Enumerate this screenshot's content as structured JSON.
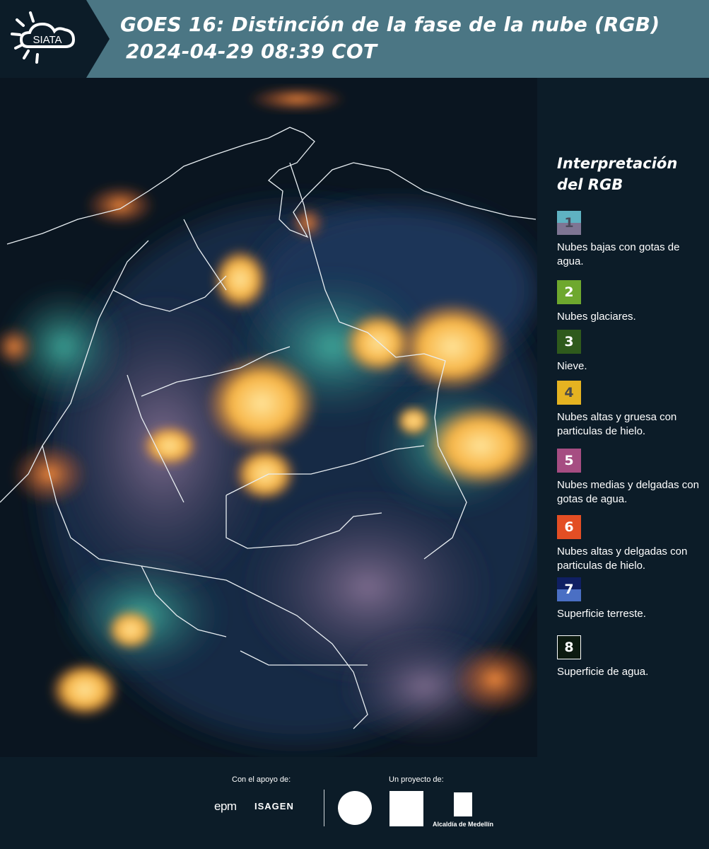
{
  "header": {
    "logo_text": "SIATA",
    "title_line1": "GOES 16: Distinción de la fase de la nube (RGB)",
    "title_line2": "2024-04-29 08:39 COT"
  },
  "legend": {
    "title_line1": "Interpretación",
    "title_line2": "del RGB",
    "items": [
      {
        "number": "1",
        "label": "Nubes bajas con gotas de agua.",
        "color_top": "#5fb2c2",
        "color_bottom": "#7e7593",
        "number_color": "#4a4a5a"
      },
      {
        "number": "2",
        "label": "Nubes glaciares.",
        "color_top": "#6ea82e",
        "color_bottom": "#6ea82e",
        "number_color": "#ffffff"
      },
      {
        "number": "3",
        "label": "Nieve.",
        "color_top": "#2f5a1c",
        "color_bottom": "#2f5a1c",
        "number_color": "#ffffff"
      },
      {
        "number": "4",
        "label": "Nubes altas y gruesa con particulas de hielo.",
        "color_top": "#e5b321",
        "color_bottom": "#e5b321",
        "number_color": "#4a4a4a"
      },
      {
        "number": "5",
        "label": "Nubes medias y delgadas con gotas de agua.",
        "color_top": "#a64d82",
        "color_bottom": "#a64d82",
        "number_color": "#ffffff"
      },
      {
        "number": "6",
        "label": "Nubes altas y delgadas con particulas de hielo.",
        "color_top": "#e34e24",
        "color_bottom": "#e34e24",
        "number_color": "#ffffff"
      },
      {
        "number": "7",
        "label": "Superficie terreste.",
        "color_top": "#0f1f63",
        "color_bottom": "#4a6fc4",
        "number_color": "#ffffff"
      },
      {
        "number": "8",
        "label": "Superficie de agua.",
        "color_top": "#0c1a10",
        "color_bottom": "#0c1a10",
        "number_color": "#ffffff"
      }
    ]
  },
  "footer": {
    "support_label": "Con el apoyo de:",
    "project_label": "Un proyecto de:",
    "epm_logo_text": "epm",
    "isagen_logo_text": "ISAGEN",
    "alcaldia_text": "Alcaldía de Medellín"
  }
}
